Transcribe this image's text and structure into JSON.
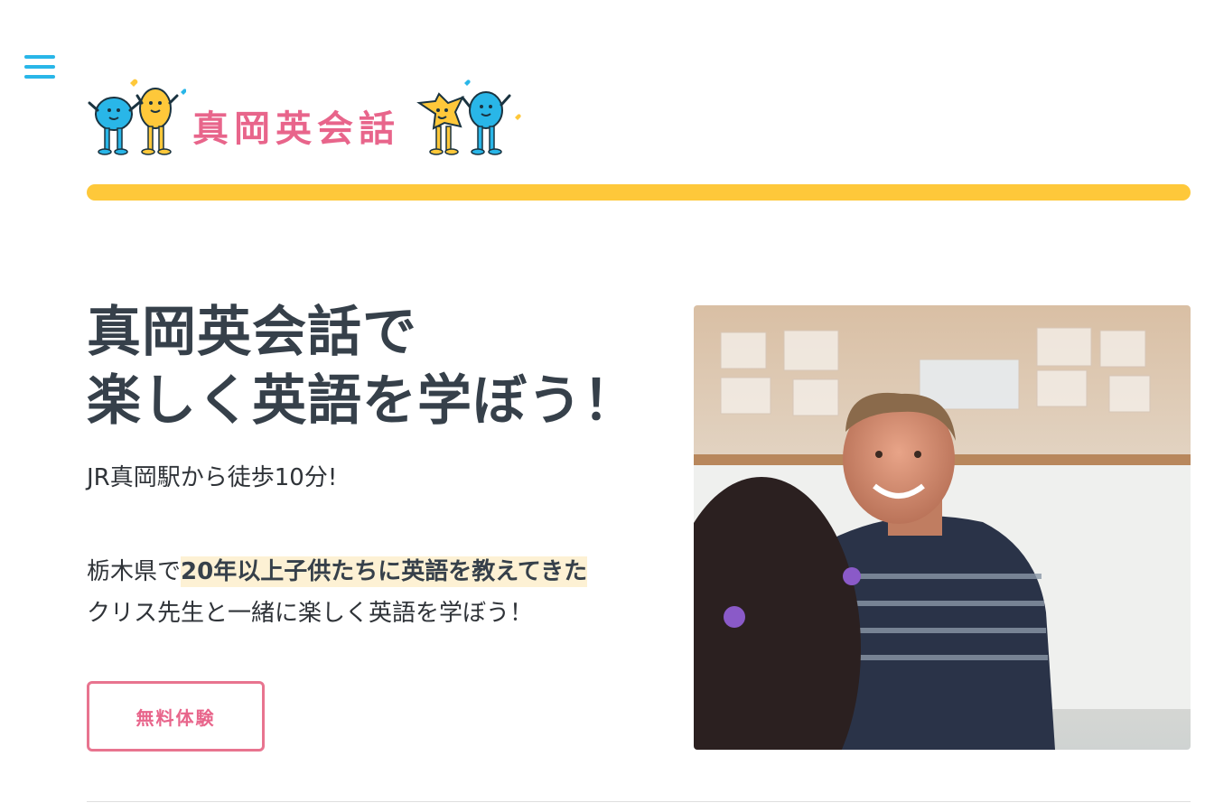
{
  "header": {
    "menu_icon": "hamburger-menu-icon",
    "logo_text": "真岡英会話"
  },
  "hero": {
    "title_line1": "真岡英会話で",
    "title_line2": "楽しく英語を学ぼう！",
    "subtitle": "JR真岡駅から徒歩10分!",
    "desc_prefix": "栃木県で",
    "desc_highlight": "20年以上子供たちに英語を教えてきた",
    "desc_line2": "クリス先生と一緒に楽しく英語を学ぼう！",
    "cta_label": "無料体験"
  },
  "photo": {
    "description_icon": "teacher-photo"
  },
  "colors": {
    "accent_blue": "#29b6e8",
    "accent_yellow": "#fec83a",
    "accent_pink": "#e8658b",
    "text_dark": "#36404a"
  }
}
